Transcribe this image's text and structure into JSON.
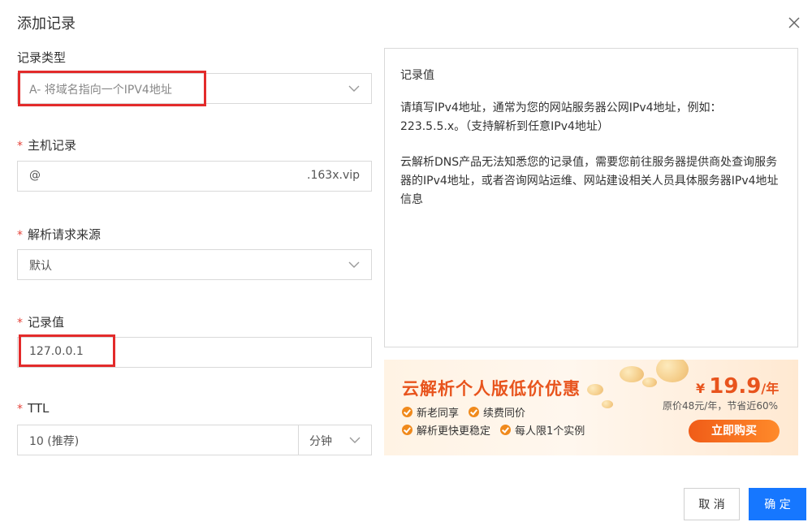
{
  "dialog": {
    "title": "添加记录"
  },
  "form": {
    "record_type": {
      "label": "记录类型",
      "value": "A- 将域名指向一个IPV4地址"
    },
    "host": {
      "required": "*",
      "label": "主机记录",
      "value": "@",
      "suffix": ".163x.vip"
    },
    "source": {
      "required": "*",
      "label": "解析请求来源",
      "value": "默认"
    },
    "record_value": {
      "required": "*",
      "label": "记录值",
      "value": "127.0.0.1"
    },
    "ttl": {
      "required": "*",
      "label": "TTL",
      "value": "10 (推荐)",
      "unit": "分钟"
    }
  },
  "info_panel": {
    "title": "记录值",
    "para1": "请填写IPv4地址，通常为您的网站服务器公网IPv4地址，例如：223.5.5.x。（支持解析到任意IPv4地址）",
    "para2": "云解析DNS产品无法知悉您的记录值，需要您前往服务器提供商处查询服务器的IPv4地址，或者咨询网站运维、网站建设相关人员具体服务器IPv4地址信息"
  },
  "promo": {
    "headline": "云解析个人版低价优惠",
    "features": [
      "新老同享",
      "续费同价",
      "解析更快更稳定",
      "每人限1个实例"
    ],
    "price_currency": "¥",
    "price_value": "19.9",
    "price_unit": "/年",
    "original": "原价48元/年，节省近60%",
    "buy_label": "立即购买"
  },
  "footer": {
    "cancel_label": "取 消",
    "ok_label": "确 定"
  },
  "colors": {
    "accent": "#1677ff",
    "required": "#e5433a",
    "highlight": "#e32b2b",
    "promo_orange": "#e8541d"
  }
}
